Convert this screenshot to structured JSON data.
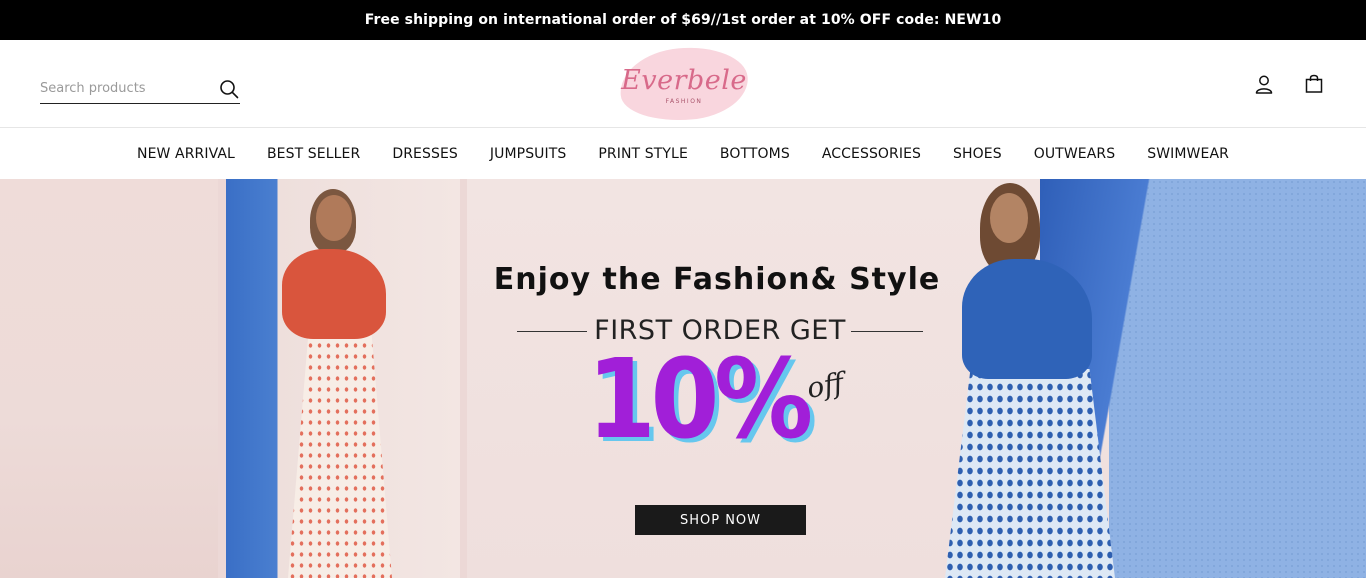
{
  "announcement": "Free shipping on international order of $69//1st order at 10% OFF code: NEW10",
  "header": {
    "search_placeholder": "Search products",
    "logo_text": "Everbele",
    "logo_subtext": "FASHION",
    "icons": [
      "search-icon",
      "user-icon",
      "bag-icon"
    ]
  },
  "nav": {
    "items": [
      "NEW ARRIVAL",
      "BEST SELLER",
      "DRESSES",
      "JUMPSUITS",
      "PRINT STYLE",
      "BOTTOMS",
      "ACCESSORIES",
      "SHOES",
      "OUTWEARS",
      "SWIMWEAR"
    ]
  },
  "hero": {
    "title": "Enjoy the Fashion& Style",
    "subtitle": "FIRST ORDER GET",
    "big_text": "10%",
    "off_text": "off",
    "cta": "SHOP NOW"
  }
}
